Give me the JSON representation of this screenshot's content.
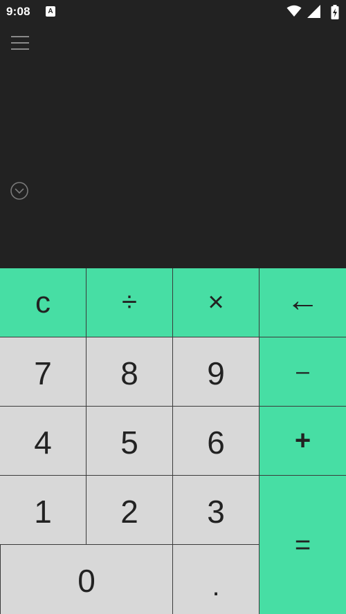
{
  "status_bar": {
    "time": "9:08",
    "app_icon_letter": "A",
    "icons": [
      "wifi-icon",
      "signal-icon",
      "battery-charging-icon"
    ]
  },
  "display": {
    "menu_icon": "hamburger-menu-icon",
    "expand_icon": "chevron-down-circle-icon"
  },
  "colors": {
    "background": "#222222",
    "operator_key": "#47dea4",
    "number_key": "#d8d8d8",
    "key_text": "#222222"
  },
  "keypad": {
    "clear": "c",
    "divide": "÷",
    "multiply": "×",
    "backspace": "←",
    "minus": "–",
    "plus": "+",
    "equals": "=",
    "decimal": ".",
    "digits": {
      "d0": "0",
      "d1": "1",
      "d2": "2",
      "d3": "3",
      "d4": "4",
      "d5": "5",
      "d6": "6",
      "d7": "7",
      "d8": "8",
      "d9": "9"
    }
  }
}
